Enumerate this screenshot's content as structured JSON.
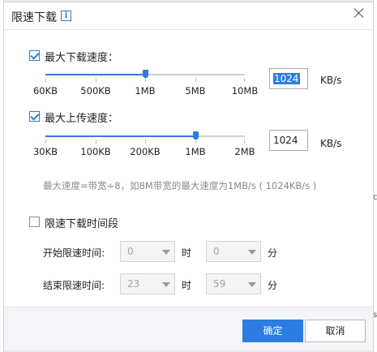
{
  "background": {
    "right_edge_glyph_top": "c",
    "right_edge_glyph_bottom": "s"
  },
  "dialog": {
    "title": "限速下载",
    "info_icon_glyph": "i"
  },
  "download": {
    "label": "最大下载速度：",
    "checked": true,
    "ticks": [
      "60KB",
      "500KB",
      "1MB",
      "5MB",
      "10MB"
    ],
    "level": 0.5,
    "value": "1024",
    "unit": "KB/s"
  },
  "upload": {
    "label": "最大上传速度：",
    "checked": true,
    "ticks": [
      "30KB",
      "100KB",
      "200KB",
      "1MB",
      "2MB"
    ],
    "level": 0.75,
    "value": "1024",
    "unit": "KB/s"
  },
  "hint": "最大速度=带宽÷8，如8M带宽的最大速度为1MB/s ( 1024KB/s )",
  "schedule": {
    "label": "限速下载时间段",
    "checked": false,
    "start_label": "开始限速时间:",
    "end_label": "结束限速时间:",
    "start_hour": "0",
    "start_minute": "0",
    "end_hour": "23",
    "end_minute": "59",
    "hour_unit": "时",
    "minute_unit": "分"
  },
  "buttons": {
    "ok": "确定",
    "cancel": "取消"
  },
  "colors": {
    "accent": "#2b7de1",
    "hint": "#8a8a8a",
    "footer": "#f3f5f8"
  }
}
